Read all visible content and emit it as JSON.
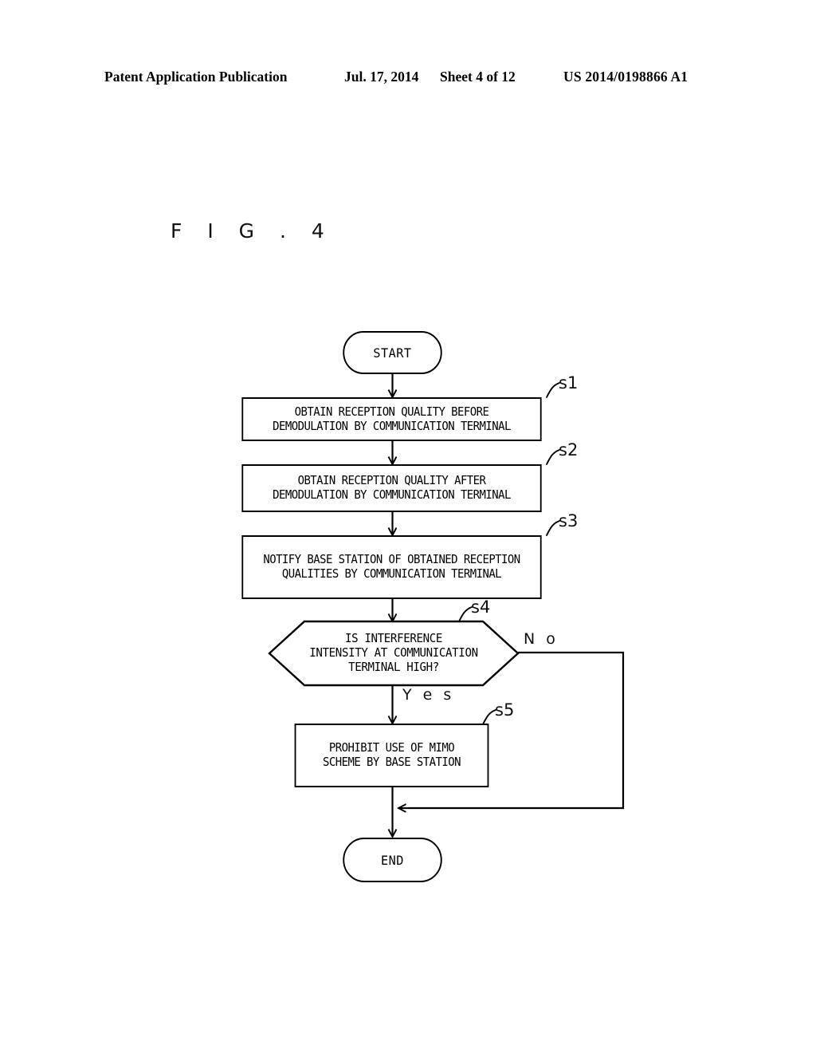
{
  "header": {
    "publication": "Patent Application Publication",
    "date": "Jul. 17, 2014",
    "sheet": "Sheet 4 of 12",
    "patent_number": "US 2014/0198866 A1"
  },
  "figure": {
    "label": "F I G .  4"
  },
  "flowchart": {
    "start": {
      "label": "START"
    },
    "end": {
      "label": "END"
    },
    "steps": [
      {
        "ref": "s1",
        "text": "OBTAIN RECEPTION QUALITY BEFORE\nDEMODULATION BY COMMUNICATION TERMINAL"
      },
      {
        "ref": "s2",
        "text": "OBTAIN RECEPTION QUALITY AFTER\nDEMODULATION BY COMMUNICATION TERMINAL"
      },
      {
        "ref": "s3",
        "text": "NOTIFY BASE STATION OF OBTAINED RECEPTION\nQUALITIES BY COMMUNICATION TERMINAL"
      },
      {
        "ref": "s4",
        "text": "IS INTERFERENCE\nINTENSITY AT COMMUNICATION\nTERMINAL HIGH?"
      },
      {
        "ref": "s5",
        "text": "PROHIBIT USE OF MIMO\nSCHEME BY BASE STATION"
      }
    ],
    "branches": {
      "yes": "Y e s",
      "no": "N o"
    }
  },
  "colors": {
    "ink": "#000000",
    "background": "#ffffff"
  }
}
